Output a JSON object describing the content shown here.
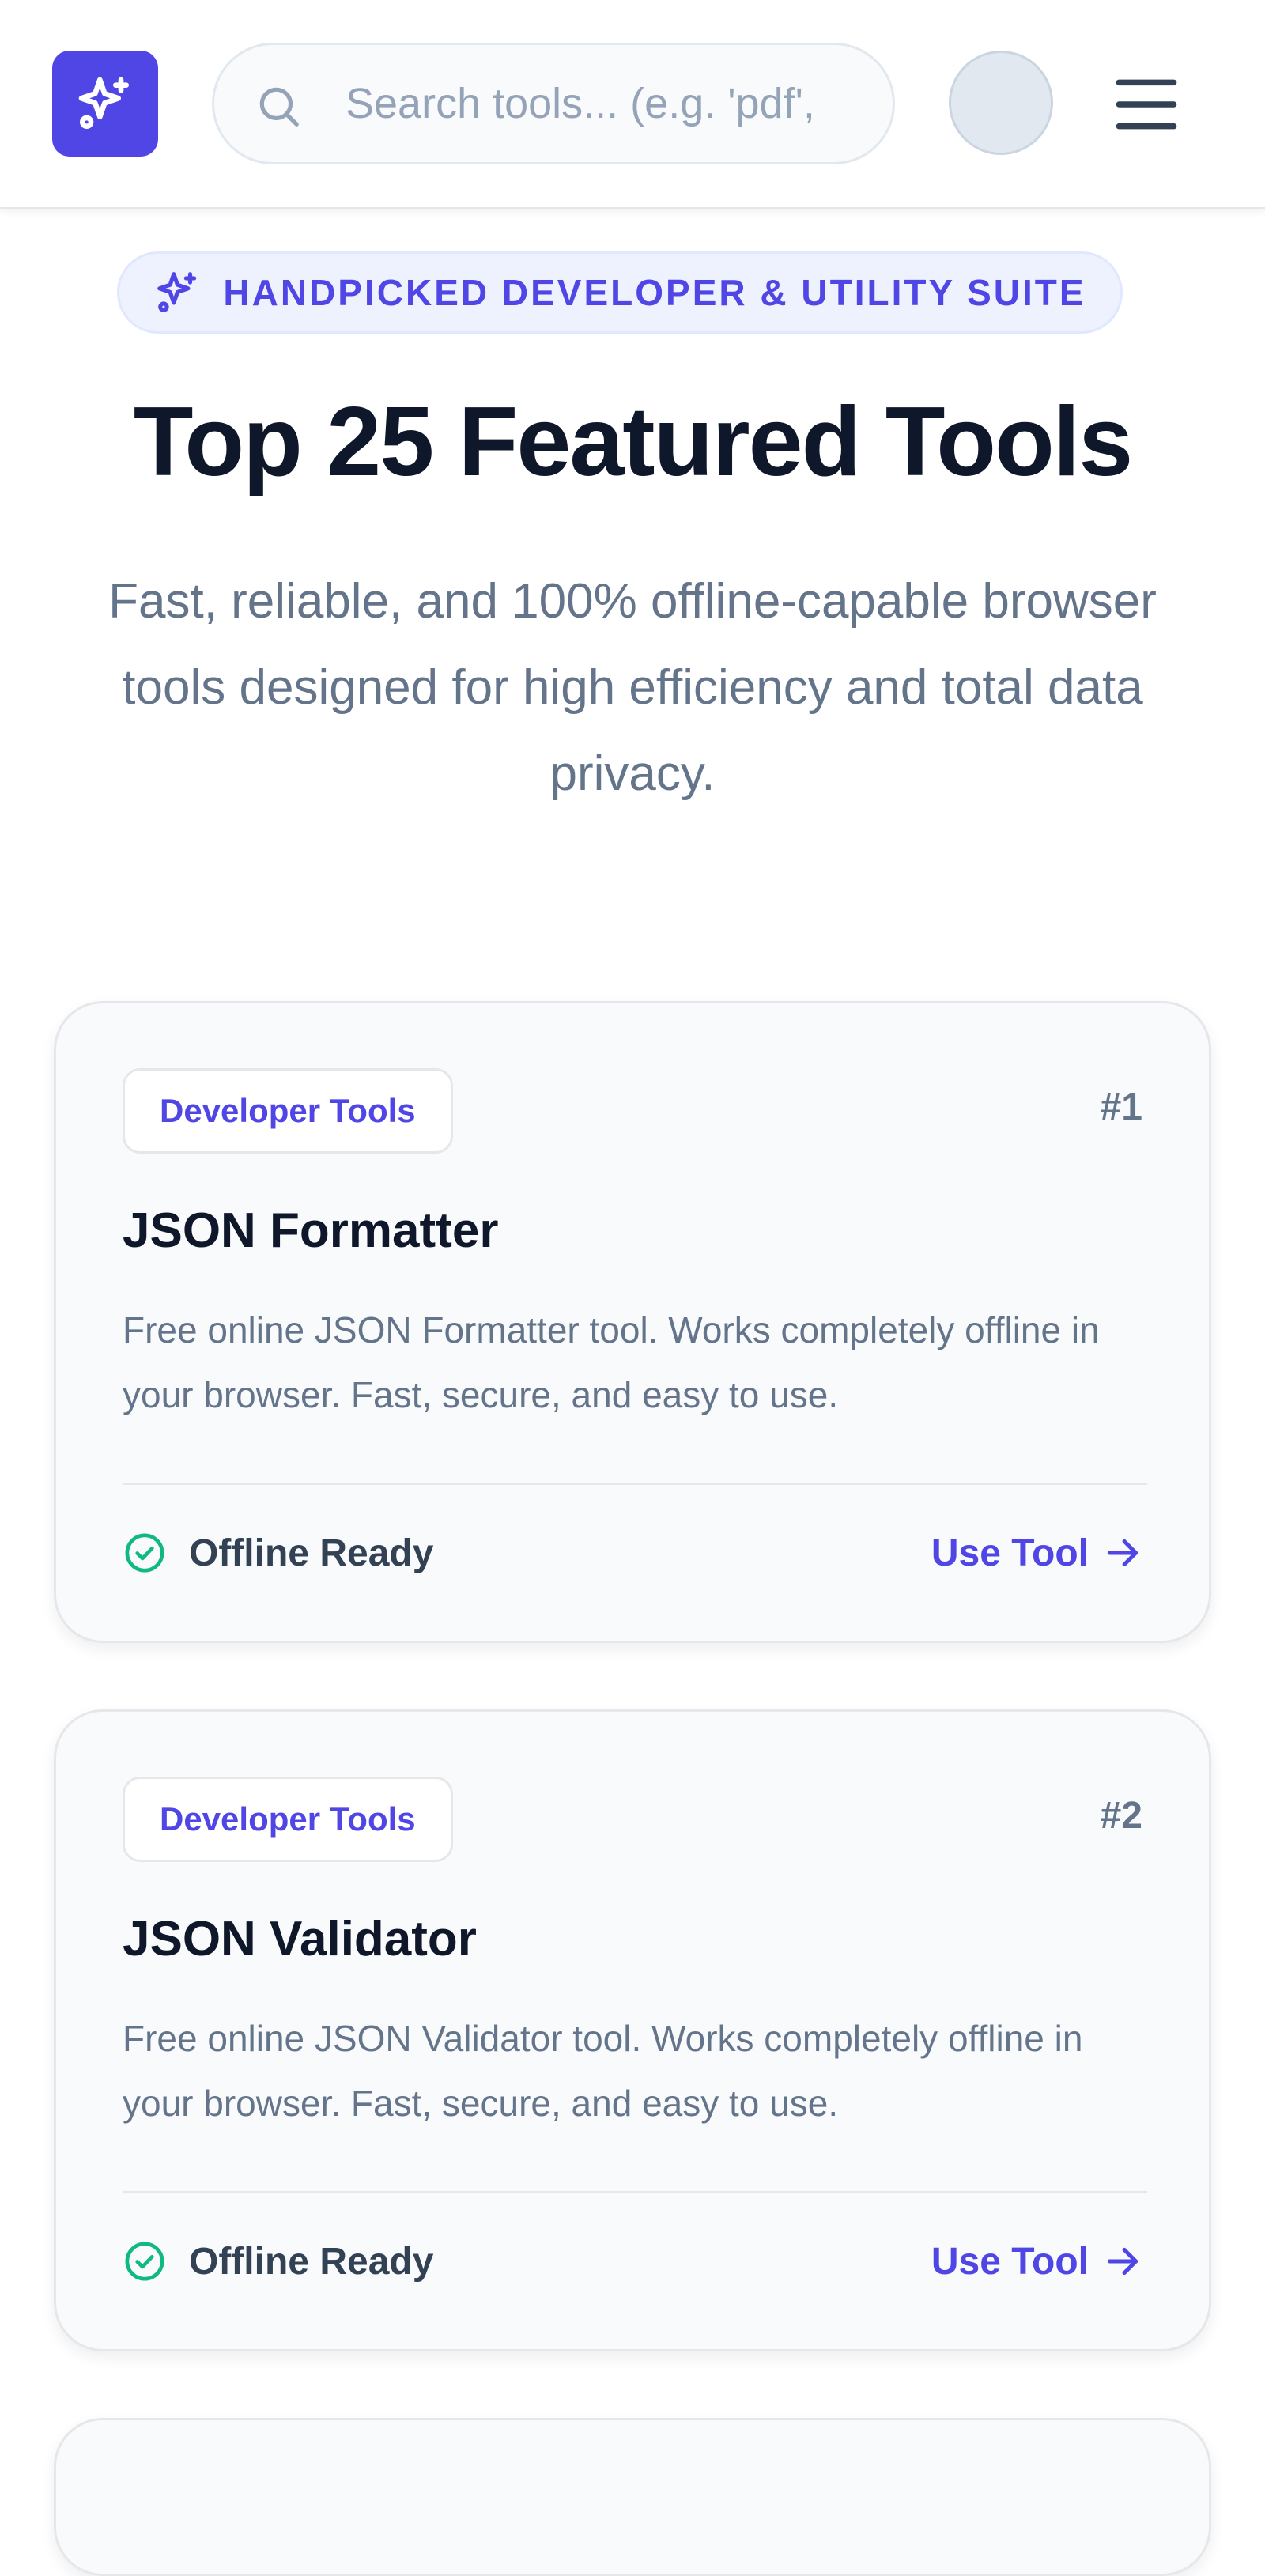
{
  "header": {
    "search_placeholder": "Search tools... (e.g. 'pdf',"
  },
  "hero": {
    "badge": "HANDPICKED DEVELOPER & UTILITY SUITE",
    "title": "Top 25 Featured Tools",
    "subtitle": "Fast, reliable, and 100% offline-capable browser tools designed for high efficiency and total data privacy."
  },
  "tools": [
    {
      "category": "Developer Tools",
      "rank": "#1",
      "name": "JSON Formatter",
      "description": "Free online JSON Formatter tool. Works completely offline in your browser. Fast, secure, and easy to use.",
      "status": "Offline Ready",
      "action": "Use Tool"
    },
    {
      "category": "Developer Tools",
      "rank": "#2",
      "name": "JSON Validator",
      "description": "Free online JSON Validator tool. Works completely offline in your browser. Fast, secure, and easy to use.",
      "status": "Offline Ready",
      "action": "Use Tool"
    }
  ],
  "icons": {
    "logo": "sparkles-icon",
    "search": "search-icon",
    "menu": "menu-icon",
    "badge": "sparkles-icon",
    "status": "check-circle-icon",
    "action": "arrow-right-icon"
  },
  "colors": {
    "brand": "#4f46e5",
    "success": "#10b981",
    "title": "#0f172a",
    "muted": "#64748b",
    "card_bg": "#f8fafc"
  }
}
